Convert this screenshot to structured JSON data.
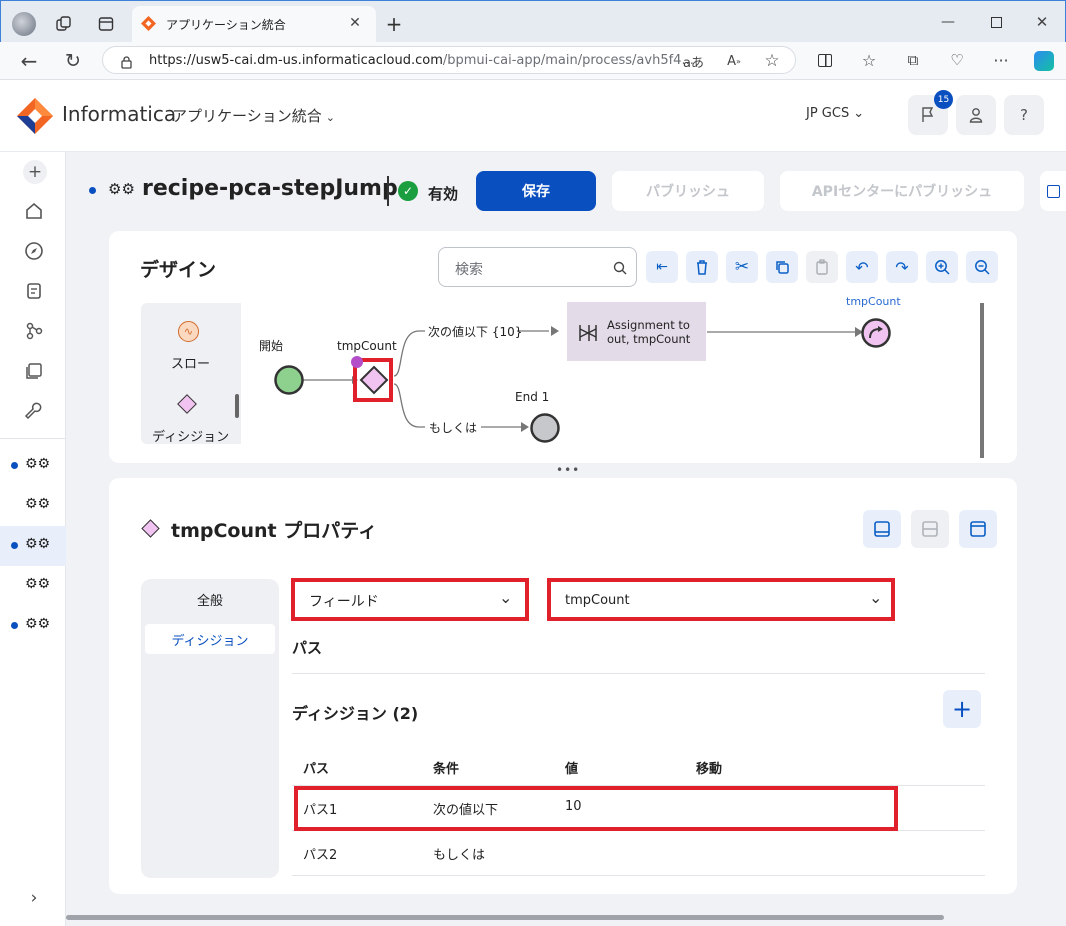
{
  "browser": {
    "tab_title": "アプリケーション統合",
    "url_host": "https://usw5-cai.dm-us.informaticacloud.com",
    "url_path": "/bpmui-cai-app/main/process/avh5f4...",
    "read_aloud": "aあ"
  },
  "header": {
    "brand": "Informatica",
    "app_name": "アプリケーション統合",
    "org": "JP GCS",
    "notification_count": "15",
    "help": "?"
  },
  "process": {
    "name": "recipe-pca-stepJump",
    "status": "有効",
    "save": "保存",
    "publish": "パブリッシュ",
    "publish_api": "APIセンターにパブリッシュ"
  },
  "design": {
    "title": "デザイン",
    "search_placeholder": "検索",
    "palette": {
      "flow": "スロー",
      "decision": "ディシジョン"
    },
    "nodes": {
      "start": "開始",
      "decision": "tmpCount",
      "assignment_line1": "Assignment to",
      "assignment_line2": "out, tmpCount",
      "jump_label": "tmpCount",
      "end": "End 1"
    },
    "edges": {
      "le": "次の値以下 {10}",
      "otherwise": "もしくは"
    }
  },
  "properties": {
    "title": "tmpCount プロパティ",
    "tabs": [
      "全般",
      "ディシジョン"
    ],
    "field_select": "フィールド",
    "field_value": "tmpCount",
    "path_label": "パス",
    "decision_count": "ディシジョン (2)",
    "table": {
      "headers": [
        "パス",
        "条件",
        "値",
        "移動"
      ],
      "rows": [
        [
          "パス1",
          "次の値以下",
          "10",
          ""
        ],
        [
          "パス2",
          "もしくは",
          "",
          ""
        ]
      ]
    }
  },
  "colors": {
    "primary": "#0a4fc0",
    "accent": "#f26522",
    "red_box": "#e0202a",
    "decision": "#f0c3f0",
    "start": "#8ed08e"
  }
}
